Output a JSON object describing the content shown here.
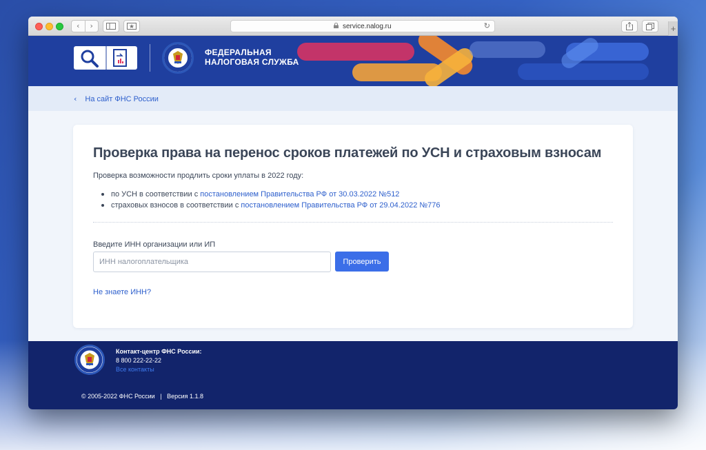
{
  "browser": {
    "url": "service.nalog.ru",
    "back_icon": "‹",
    "forward_icon": "›",
    "new_tab_icon": "+"
  },
  "header": {
    "org_line1": "ФЕДЕРАЛЬНАЯ",
    "org_line2": "НАЛОГОВАЯ СЛУЖБА",
    "brand_color": "#1f3f9f"
  },
  "subnav": {
    "back_label": "На сайт ФНС России"
  },
  "main": {
    "title": "Проверка права на перенос сроков платежей по УСН и страховым взносам",
    "intro": "Проверка возможности продлить сроки уплаты в 2022 году:",
    "bullets": [
      {
        "prefix": "по УСН в соответствии с ",
        "link": "постановлением Правительства РФ от 30.03.2022 №512"
      },
      {
        "prefix": "страховых взносов в соответствии с ",
        "link": "постановлением Правительства РФ от 29.04.2022 №776"
      }
    ],
    "inn_label": "Введите ИНН организации или ИП",
    "inn_placeholder": "ИНН налогоплательщика",
    "inn_value": "",
    "check_button": "Проверить",
    "help_link": "Не знаете ИНН?",
    "accent_color": "#3b6ee8"
  },
  "footer": {
    "contact_title": "Контакт-центр ФНС России:",
    "phone": "8 800 222-22-22",
    "contacts_link": "Все контакты",
    "copyright": "© 2005-2022 ФНС России",
    "separator": "|",
    "version": "Версия 1.1.8"
  }
}
